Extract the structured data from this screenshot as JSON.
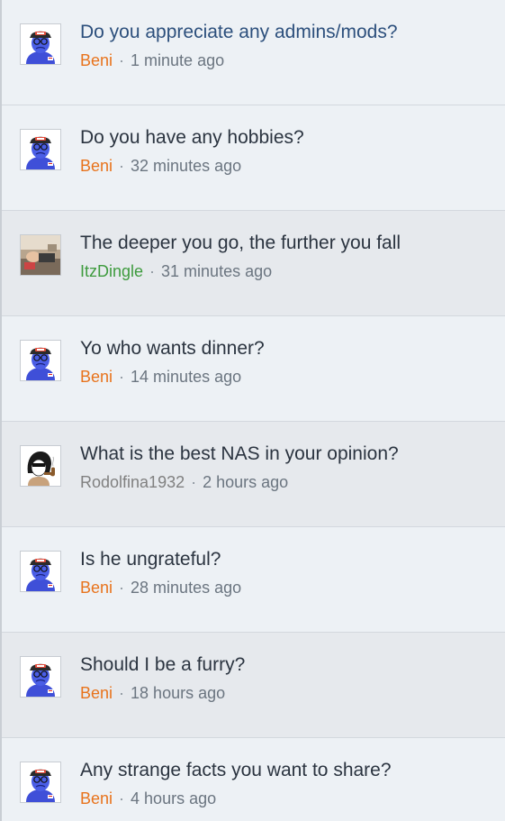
{
  "threads": [
    {
      "title": "Do you appreciate any admins/mods?",
      "author": "Beni",
      "author_color": "#e8731c",
      "time": "1 minute ago",
      "avatar": "beni-avatar",
      "highlight": true,
      "alt": false
    },
    {
      "title": "Do you have any hobbies?",
      "author": "Beni",
      "author_color": "#e8731c",
      "time": "32 minutes ago",
      "avatar": "beni-avatar",
      "highlight": false,
      "alt": false
    },
    {
      "title": "The deeper you go, the further you fall",
      "author": "ItzDingle",
      "author_color": "#3e9b3e",
      "time": "31 minutes ago",
      "avatar": "photo-avatar",
      "highlight": false,
      "alt": true
    },
    {
      "title": "Yo who wants dinner?",
      "author": "Beni",
      "author_color": "#e8731c",
      "time": "14 minutes ago",
      "avatar": "beni-avatar",
      "highlight": false,
      "alt": false
    },
    {
      "title": "What is the best NAS in your opinion?",
      "author": "Rodolfina1932",
      "author_color": "#808080",
      "time": "2 hours ago",
      "avatar": "pipe-avatar",
      "highlight": false,
      "alt": true
    },
    {
      "title": "Is he ungrateful?",
      "author": "Beni",
      "author_color": "#e8731c",
      "time": "28 minutes ago",
      "avatar": "beni-avatar",
      "highlight": false,
      "alt": false
    },
    {
      "title": "Should I be a furry?",
      "author": "Beni",
      "author_color": "#e8731c",
      "time": "18 hours ago",
      "avatar": "beni-avatar",
      "highlight": false,
      "alt": true
    },
    {
      "title": "Any strange facts you want to share?",
      "author": "Beni",
      "author_color": "#e8731c",
      "time": "4 hours ago",
      "avatar": "beni-avatar",
      "highlight": false,
      "alt": false
    }
  ],
  "separator": "·"
}
